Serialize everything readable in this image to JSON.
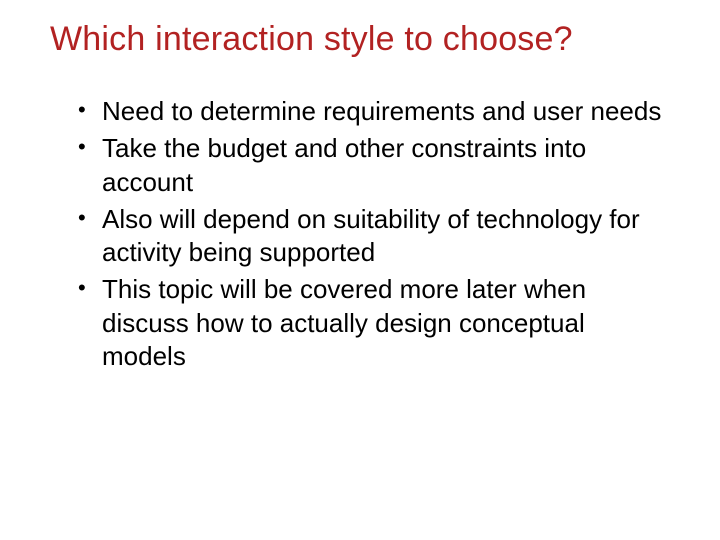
{
  "title": "Which interaction style to choose?",
  "bullets": [
    "Need to determine requirements and user needs",
    "Take the budget and other constraints into account",
    "Also will depend on suitability of technology for activity being supported",
    "This topic will be covered more later when discuss how to actually design conceptual models"
  ]
}
